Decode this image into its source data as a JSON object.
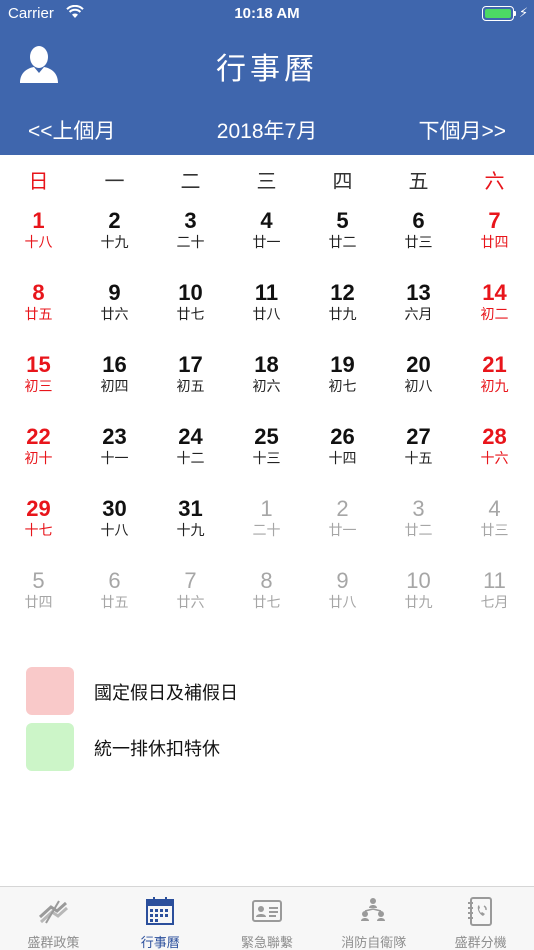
{
  "status_bar": {
    "carrier": "Carrier",
    "time": "10:18 AM"
  },
  "header": {
    "title": "行事曆",
    "prev_label": "<<上個月",
    "month_label": "2018年7月",
    "next_label": "下個月>>"
  },
  "weekdays": [
    "日",
    "一",
    "二",
    "三",
    "四",
    "五",
    "六"
  ],
  "days": [
    {
      "day": "1",
      "lunar": "十八",
      "current": true
    },
    {
      "day": "2",
      "lunar": "十九",
      "current": true
    },
    {
      "day": "3",
      "lunar": "二十",
      "current": true
    },
    {
      "day": "4",
      "lunar": "廿一",
      "current": true
    },
    {
      "day": "5",
      "lunar": "廿二",
      "current": true
    },
    {
      "day": "6",
      "lunar": "廿三",
      "current": true
    },
    {
      "day": "7",
      "lunar": "廿四",
      "current": true
    },
    {
      "day": "8",
      "lunar": "廿五",
      "current": true
    },
    {
      "day": "9",
      "lunar": "廿六",
      "current": true
    },
    {
      "day": "10",
      "lunar": "廿七",
      "current": true
    },
    {
      "day": "11",
      "lunar": "廿八",
      "current": true
    },
    {
      "day": "12",
      "lunar": "廿九",
      "current": true
    },
    {
      "day": "13",
      "lunar": "六月",
      "current": true
    },
    {
      "day": "14",
      "lunar": "初二",
      "current": true
    },
    {
      "day": "15",
      "lunar": "初三",
      "current": true
    },
    {
      "day": "16",
      "lunar": "初四",
      "current": true
    },
    {
      "day": "17",
      "lunar": "初五",
      "current": true
    },
    {
      "day": "18",
      "lunar": "初六",
      "current": true
    },
    {
      "day": "19",
      "lunar": "初七",
      "current": true
    },
    {
      "day": "20",
      "lunar": "初八",
      "current": true
    },
    {
      "day": "21",
      "lunar": "初九",
      "current": true
    },
    {
      "day": "22",
      "lunar": "初十",
      "current": true
    },
    {
      "day": "23",
      "lunar": "十一",
      "current": true
    },
    {
      "day": "24",
      "lunar": "十二",
      "current": true
    },
    {
      "day": "25",
      "lunar": "十三",
      "current": true
    },
    {
      "day": "26",
      "lunar": "十四",
      "current": true
    },
    {
      "day": "27",
      "lunar": "十五",
      "current": true
    },
    {
      "day": "28",
      "lunar": "十六",
      "current": true
    },
    {
      "day": "29",
      "lunar": "十七",
      "current": true
    },
    {
      "day": "30",
      "lunar": "十八",
      "current": true
    },
    {
      "day": "31",
      "lunar": "十九",
      "current": true
    },
    {
      "day": "1",
      "lunar": "二十",
      "current": false
    },
    {
      "day": "2",
      "lunar": "廿一",
      "current": false
    },
    {
      "day": "3",
      "lunar": "廿二",
      "current": false
    },
    {
      "day": "4",
      "lunar": "廿三",
      "current": false
    },
    {
      "day": "5",
      "lunar": "廿四",
      "current": false
    },
    {
      "day": "6",
      "lunar": "廿五",
      "current": false
    },
    {
      "day": "7",
      "lunar": "廿六",
      "current": false
    },
    {
      "day": "8",
      "lunar": "廿七",
      "current": false
    },
    {
      "day": "9",
      "lunar": "廿八",
      "current": false
    },
    {
      "day": "10",
      "lunar": "廿九",
      "current": false
    },
    {
      "day": "11",
      "lunar": "七月",
      "current": false
    }
  ],
  "legend": [
    {
      "label": "國定假日及補假日",
      "color": "#f9c9c9"
    },
    {
      "label": "統一排休扣特休",
      "color": "#ccf5c8"
    }
  ],
  "tabs": [
    {
      "label": "盛群政策",
      "icon": "policy-icon",
      "active": false
    },
    {
      "label": "行事曆",
      "icon": "calendar-icon",
      "active": true
    },
    {
      "label": "緊急聯繫",
      "icon": "contact-card-icon",
      "active": false
    },
    {
      "label": "消防自衛隊",
      "icon": "team-icon",
      "active": false
    },
    {
      "label": "盛群分機",
      "icon": "phone-book-icon",
      "active": false
    }
  ],
  "colors": {
    "header": "#3f66ad",
    "weekend": "#e8151b",
    "other_month": "#a6a6a6",
    "tab_active": "#2b4f9c",
    "tab_inactive": "#8e8e8e"
  }
}
